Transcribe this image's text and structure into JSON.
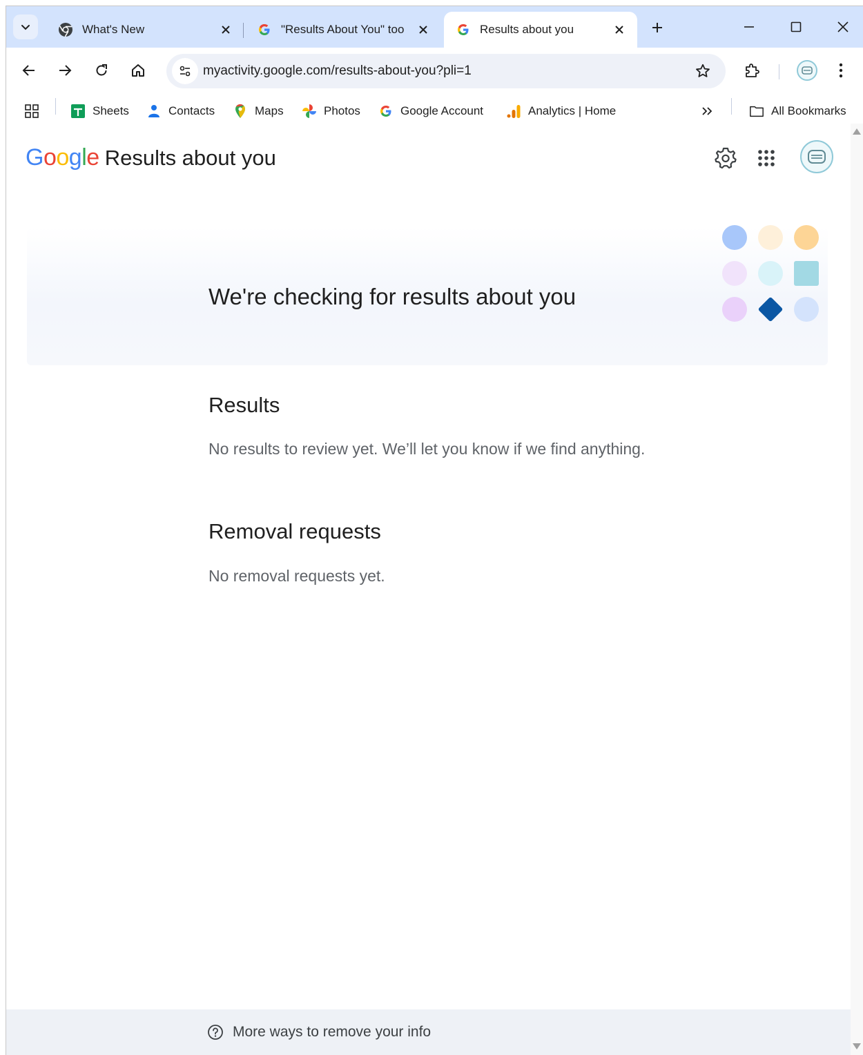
{
  "browser": {
    "tabs": [
      {
        "title": "What's New",
        "favicon": "chrome-icon",
        "active": false
      },
      {
        "title": "\"Results About You\" too",
        "favicon": "google-g-icon",
        "active": false
      },
      {
        "title": "Results about you",
        "favicon": "google-g-icon",
        "active": true
      }
    ],
    "url": "myactivity.google.com/results-about-you?pli=1",
    "bookmarks": [
      {
        "label": "Sheets",
        "icon": "sheets-icon"
      },
      {
        "label": "Contacts",
        "icon": "contacts-icon"
      },
      {
        "label": "Maps",
        "icon": "maps-icon"
      },
      {
        "label": "Photos",
        "icon": "photos-icon"
      },
      {
        "label": "Google Account",
        "icon": "google-g-icon"
      },
      {
        "label": "Analytics | Home",
        "icon": "analytics-icon"
      }
    ],
    "all_bookmarks": "All Bookmarks"
  },
  "page": {
    "logo": {
      "G": "G",
      "o1": "o",
      "o2": "o",
      "g": "g",
      "l": "l",
      "e": "e"
    },
    "product_name": "Results about you",
    "hero_title": "We're checking for results about you",
    "results": {
      "title": "Results",
      "text": "No results to review yet. We’ll let you know if we find anything."
    },
    "removal": {
      "title": "Removal requests",
      "text": "No removal requests yet."
    },
    "footer_link": "More ways to remove your info"
  },
  "colors": {
    "tabstrip": "#d3e3fd",
    "google_blue": "#4285f4",
    "google_red": "#ea4335",
    "google_yellow": "#fbbc05",
    "google_green": "#34a853",
    "diamond": "#0b57a4"
  }
}
